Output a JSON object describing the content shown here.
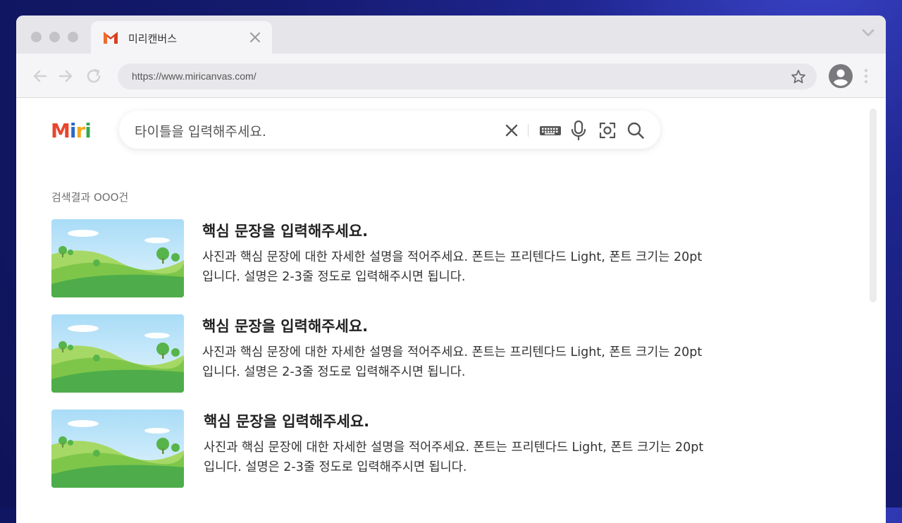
{
  "browser": {
    "tab_title": "미리캔버스",
    "url": "https://www.miricanvas.com/"
  },
  "logo": {
    "letters": [
      "M",
      "i",
      "r",
      "i"
    ],
    "colors": [
      "#e8452c",
      "#2b67c9",
      "#f3a81d",
      "#33a852"
    ]
  },
  "search": {
    "placeholder": "타이틀을 입력해주세요."
  },
  "results_count": "검색결과 OOO건",
  "results": [
    {
      "title": "핵심 문장을 입력해주세요.",
      "description": "사진과 핵심 문장에 대한 자세한 설명을 적어주세요. 폰트는 프리텐다드 Light, 폰트 크기는 20pt 입니다. 설명은 2-3줄 정도로 입력해주시면 됩니다."
    },
    {
      "title": "핵심 문장을 입력해주세요.",
      "description": "사진과 핵심 문장에 대한 자세한 설명을 적어주세요. 폰트는 프리텐다드 Light, 폰트 크기는 20pt 입니다. 설명은 2-3줄 정도로 입력해주시면 됩니다."
    },
    {
      "title": "핵심 문장을 입력해주세요.",
      "description": "사진과 핵심 문장에 대한 자세한 설명을 적어주세요. 폰트는 프리텐다드 Light, 폰트 크기는 20pt 입니다. 설명은 2-3줄 정도로 입력해주시면 됩니다."
    }
  ],
  "icons": {
    "tab_favicon": "gmail-m-icon",
    "tab_close": "close-icon",
    "back": "arrow-left-icon",
    "forward": "arrow-right-icon",
    "reload": "reload-icon",
    "bookmark": "star-icon",
    "profile": "avatar-icon",
    "menu": "kebab-menu-icon",
    "clear": "close-icon",
    "keyboard": "keyboard-icon",
    "voice": "microphone-icon",
    "lens": "camera-search-icon",
    "search": "search-icon"
  }
}
